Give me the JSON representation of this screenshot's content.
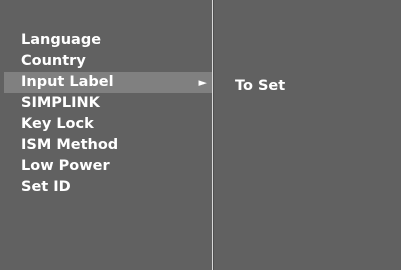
{
  "menu": {
    "items": [
      {
        "label": "Language"
      },
      {
        "label": "Country"
      },
      {
        "label": "Input Label",
        "selected": true,
        "has_submenu": true
      },
      {
        "label": "SIMPLINK"
      },
      {
        "label": "Key Lock"
      },
      {
        "label": "ISM Method"
      },
      {
        "label": "Low Power"
      },
      {
        "label": "Set ID"
      }
    ],
    "arrow_glyph": "►"
  },
  "submenu": {
    "items": [
      {
        "label": "To Set"
      }
    ]
  },
  "colors": {
    "panel_bg": "#616161",
    "highlight_bg": "#808080",
    "text": "#ffffff",
    "divider": "#d8d8d8"
  }
}
